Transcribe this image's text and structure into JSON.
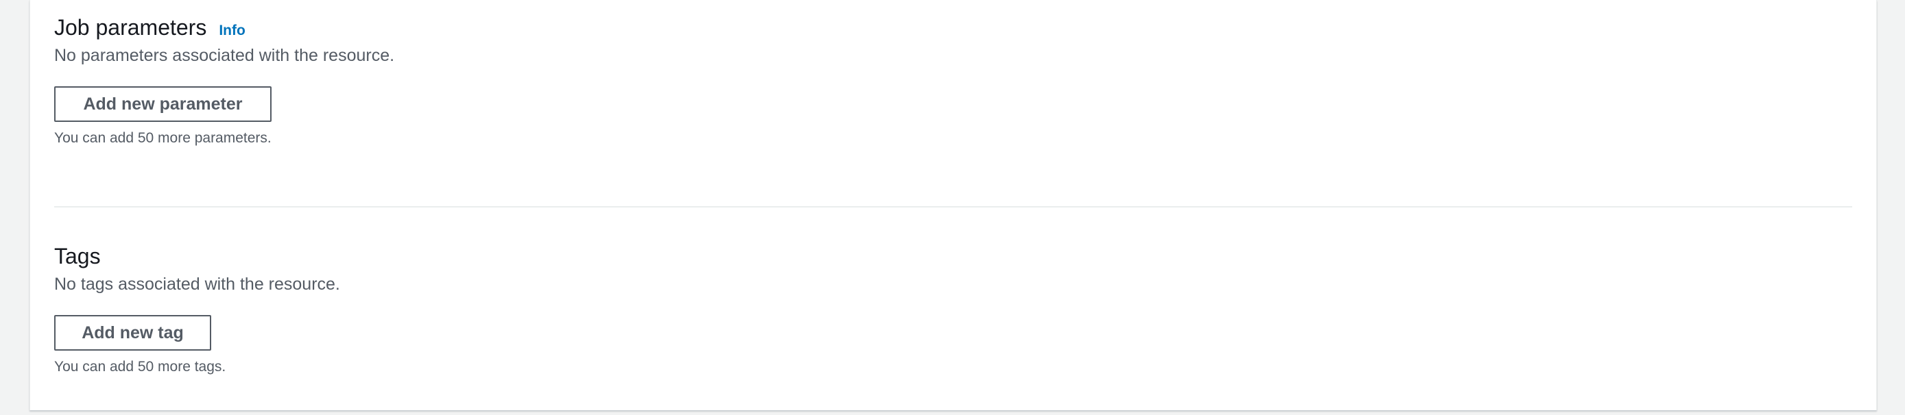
{
  "job_parameters": {
    "title": "Job parameters",
    "info_label": "Info",
    "description": "No parameters associated with the resource.",
    "add_button_label": "Add new parameter",
    "hint": "You can add 50 more parameters."
  },
  "tags": {
    "title": "Tags",
    "description": "No tags associated with the resource.",
    "add_button_label": "Add new tag",
    "hint": "You can add 50 more tags."
  }
}
